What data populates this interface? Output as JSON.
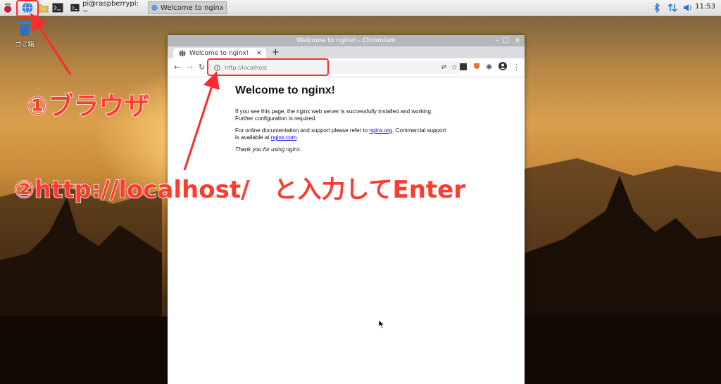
{
  "taskbar": {
    "terminal_task": "pi@raspberrypi: ~",
    "browser_task": "Welcome to nginx! - C...",
    "clock": "11:53"
  },
  "desktop": {
    "trash_label": "ゴミ箱"
  },
  "browser": {
    "window_title": "Welcome to nginx! - Chromium",
    "tab_title": "Welcome to nginx!",
    "tab_close": "×",
    "new_tab": "+",
    "url": "http://localhost"
  },
  "page": {
    "heading": "Welcome to nginx!",
    "p1": "If you see this page, the nginx web server is successfully installed and working. Further configuration is required.",
    "p2_pre": "For online documentation and support please refer to ",
    "p2_link": "nginx.org",
    "p2_mid": ". Commercial support is available at ",
    "p2_link2": "nginx.com",
    "p2_end": ".",
    "p3": "Thank you for using nginx."
  },
  "annotations": {
    "step1": "①ブラウザ",
    "step2": "②http://localhost/　と入力してEnter"
  },
  "colors": {
    "annotation": "#ff3b30",
    "link": "#0000ee"
  }
}
